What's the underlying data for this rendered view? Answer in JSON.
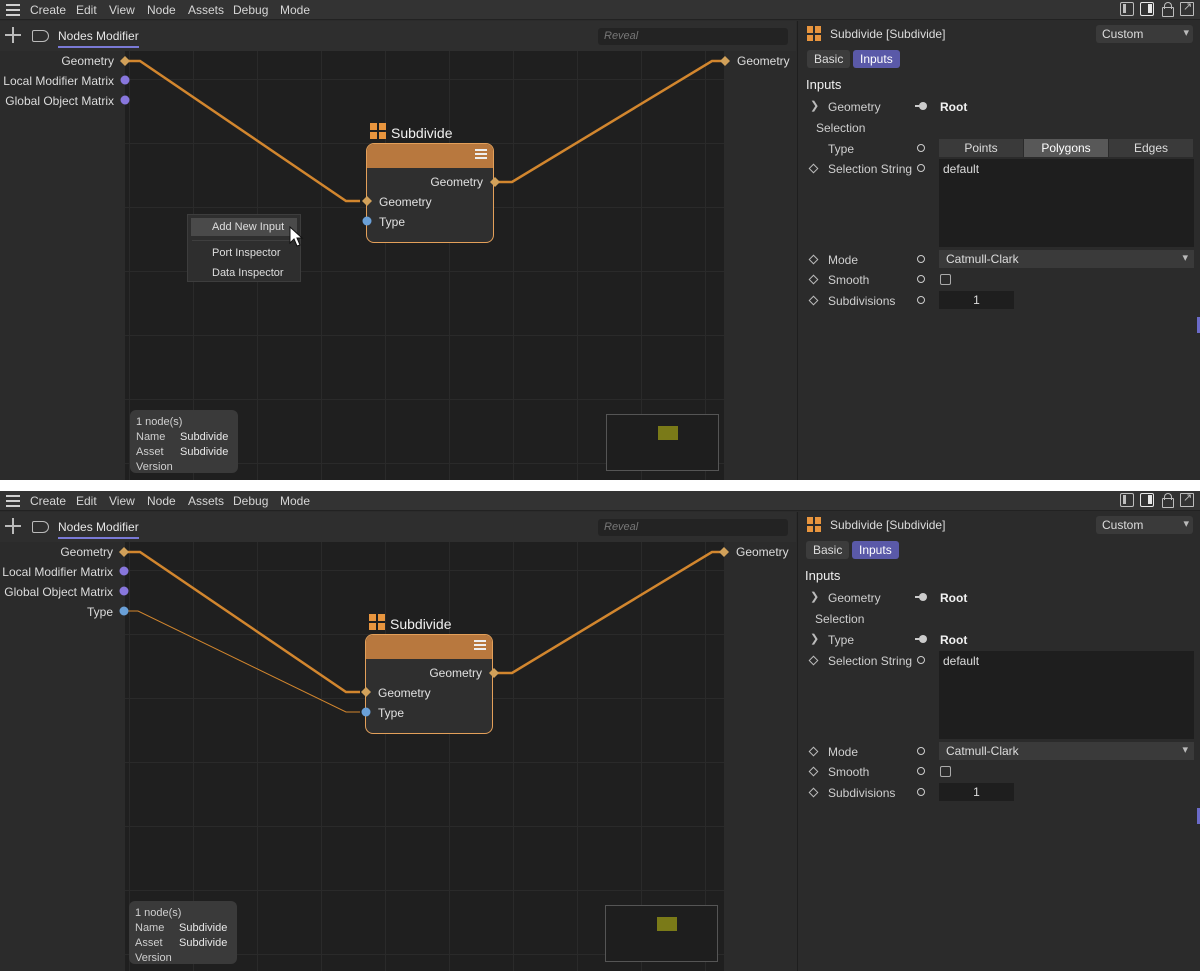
{
  "menu": [
    "Create",
    "Edit",
    "View",
    "Node",
    "Assets",
    "Debug",
    "Mode"
  ],
  "graph_tab": "Nodes Modifier",
  "reveal_placeholder": "Reveal",
  "left_ports_a": [
    "Geometry",
    "Local Modifier Matrix",
    "Global Object Matrix"
  ],
  "left_ports_b": [
    "Geometry",
    "Local Modifier Matrix",
    "Global Object Matrix",
    "Type"
  ],
  "right_port": "Geometry",
  "node": {
    "title": "Subdivide",
    "output": "Geometry",
    "inputs": [
      "Geometry",
      "Type"
    ]
  },
  "context_menu": [
    "Add New Input",
    "Port Inspector",
    "Data Inspector"
  ],
  "info": {
    "count": "1 node(s)",
    "name_label": "Name",
    "name_value": "Subdivide",
    "asset_label": "Asset",
    "asset_value": "Subdivide",
    "version_label": "Version"
  },
  "attr": {
    "title": "Subdivide [Subdivide]",
    "preset": "Custom",
    "tabs": [
      "Basic",
      "Inputs"
    ],
    "section": "Inputs",
    "geometry_label": "Geometry",
    "root": "Root",
    "selection_label": "Selection",
    "type_label": "Type",
    "type_options": [
      "Points",
      "Polygons",
      "Edges"
    ],
    "type_selected": "Polygons",
    "selection_string_label": "Selection String",
    "selection_string": "default",
    "mode_label": "Mode",
    "mode_value": "Catmull-Clark",
    "smooth_label": "Smooth",
    "smooth_checked": false,
    "subdivisions_label": "Subdivisions",
    "subdivisions_value": "1"
  },
  "colors": {
    "wire": "#d2862e",
    "node_border": "#e3a05a",
    "node_header": "#b8783e",
    "accent_tab": "#5a59a8",
    "port_matrix": "#8877dd",
    "port_type": "#6aa0d8"
  }
}
